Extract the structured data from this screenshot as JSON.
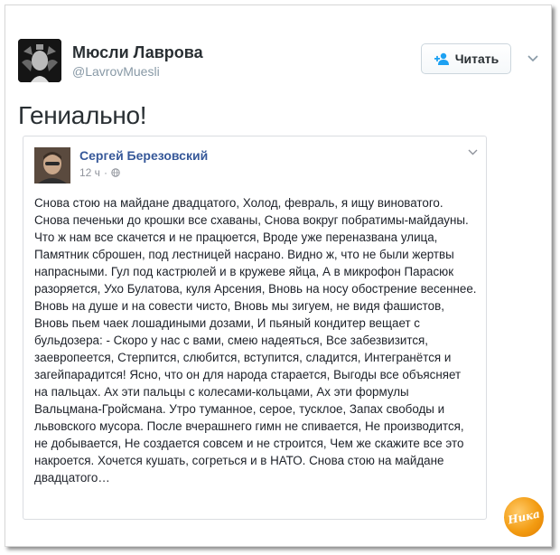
{
  "tweet": {
    "display_name": "Мюсли Лаврова",
    "handle": "@LavrovMuesli",
    "follow_label": "Читать",
    "text": "Гениально!"
  },
  "embedded_post": {
    "author": "Сергей Березовский",
    "time": "12 ч",
    "body": "Снова стою на майдане двадцатого, Холод, февраль, я ищу виноватого. Снова печеньки до крошки все схаваны, Снова вокруг побратимы-майдауны. Что ж нам все скачется и не працюется, Вроде уже переназвана улица, Памятник сброшен, под лестницей насрано. Видно ж, что не были жертвы напрасными. Гул под кастрюлей и в кружеве яйца, А в микрофон Парасюк разоряется, Ухо Булатова, куля Арсения, Вновь на носу обострение весеннее. Вновь на душе и на совести чисто, Вновь мы зигуем, не видя фашистов, Вновь пьем чаек лошадиными дозами, И пьяный кондитер вещает с бульдозера: - Скоро у нас с вами, смею надеяться, Все забезвизится, заевропеется, Стерпится, слюбится, вступится, сладится, Интегранётся и загейпарадится! Ясно, что он для народа старается, Выгоды все объясняет на пальцах. Ах эти пальцы с колесами-кольцами, Ах эти формулы Вальцмана-Гройсмана. Утро туманное, серое, тусклое, Запах свободы и львовского мусора. После вчерашнего гимн не спивается, Не производится, не добывается, Не создается совсем и не строится, Чем же скажите все это накроется. Хочется кушать, согреться и в НАТО. Снова стою на майдане двадцатого…"
  },
  "watermark": "Ника",
  "colors": {
    "name_link": "#365899",
    "text": "#1d2129",
    "muted": "#90949c",
    "twitter_blue": "#1da1f2"
  }
}
